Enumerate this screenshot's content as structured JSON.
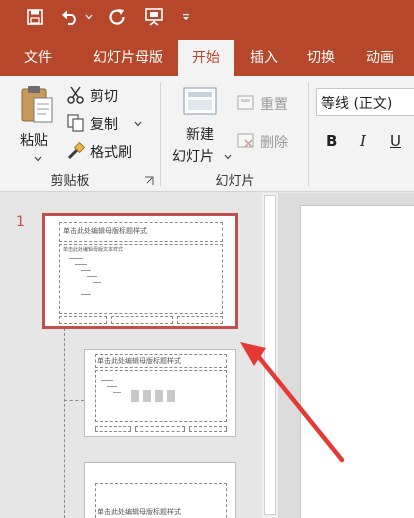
{
  "tabs": [
    "文件",
    "幻灯片母版",
    "开始",
    "插入",
    "切换",
    "动画"
  ],
  "active_tab": "开始",
  "clipboard": {
    "paste_label": "粘贴",
    "cut_label": "剪切",
    "copy_label": "复制",
    "format_painter_label": "格式刷",
    "group_label": "剪贴板"
  },
  "slides_group": {
    "new_slide_line1": "新建",
    "new_slide_line2": "幻灯片",
    "reset_label": "重置",
    "delete_label": "删除",
    "group_label": "幻灯片"
  },
  "font": {
    "font_name": "等线 (正文)",
    "bold": "B",
    "italic": "I",
    "underline": "U"
  },
  "slide_pane": {
    "selected_number": "1",
    "master_title": "单击此处编辑母版标题样式",
    "master_body": "单击此处编辑母版文本样式"
  },
  "colors": {
    "accent": "#b7472a",
    "selection": "#c0504d",
    "arrow": "#e53935"
  }
}
